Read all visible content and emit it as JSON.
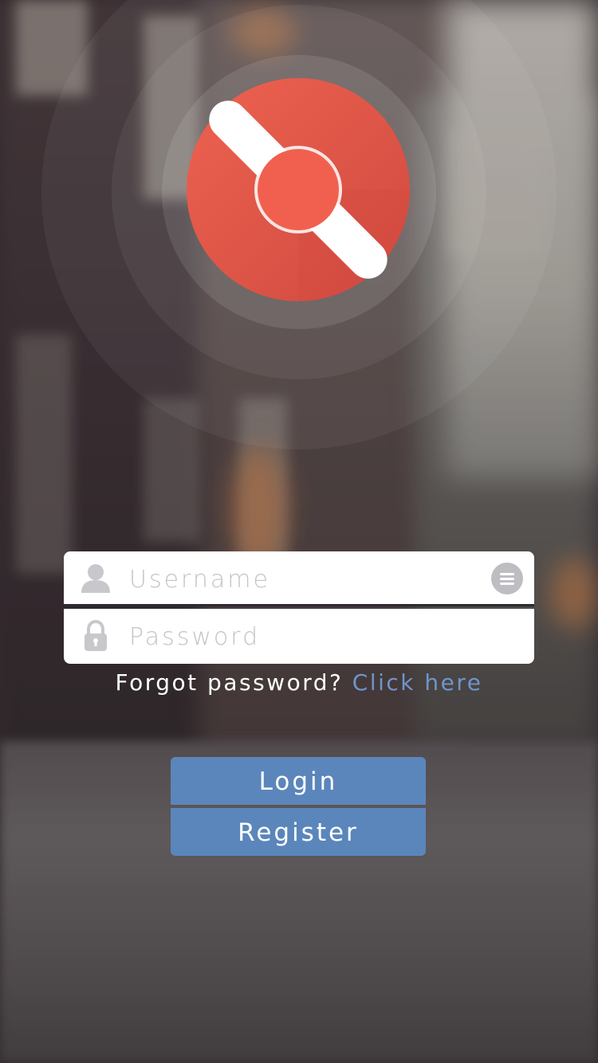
{
  "form": {
    "username_placeholder": "Username",
    "password_placeholder": "Password"
  },
  "forgot": {
    "prompt": "Forgot password?",
    "link": "Click here"
  },
  "buttons": {
    "login": "Login",
    "register": "Register"
  },
  "icons": {
    "user": "user-icon",
    "lock": "lock-icon",
    "menu": "menu-icon",
    "logo": "propeller-logo"
  },
  "colors": {
    "brand_red": "#e8594a",
    "button_blue": "#5b86bb",
    "link_blue": "#6e95c9"
  }
}
